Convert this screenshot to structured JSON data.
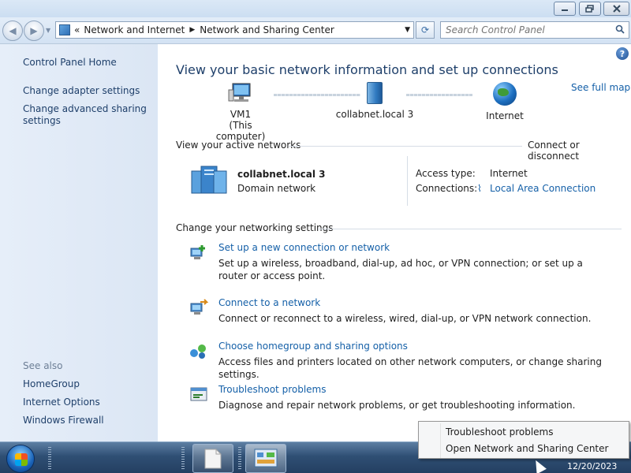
{
  "window": {
    "minimize_icon": "minimize-icon",
    "maximize_icon": "restore-icon",
    "close_icon": "close-icon"
  },
  "navbar": {
    "breadcrumb_prefix": "«",
    "crumbs": [
      "Network and Internet",
      "Network and Sharing Center"
    ],
    "search_placeholder": "Search Control Panel"
  },
  "sidebar": {
    "home": "Control Panel Home",
    "items": [
      "Change adapter settings",
      "Change advanced sharing settings"
    ],
    "see_also_label": "See also",
    "see_also": [
      "HomeGroup",
      "Internet Options",
      "Windows Firewall"
    ]
  },
  "main": {
    "heading": "View your basic network information and set up connections",
    "see_full_map": "See full map",
    "map": {
      "computer_name": "VM1",
      "computer_sub": "(This computer)",
      "network": "collabnet.local  3",
      "internet": "Internet"
    },
    "active_networks_label": "View your active networks",
    "connect_disconnect": "Connect or disconnect",
    "active_network": {
      "name": "collabnet.local  3",
      "type": "Domain network",
      "access_type_label": "Access type:",
      "access_type_value": "Internet",
      "connections_label": "Connections:",
      "connections_value": "Local Area Connection"
    },
    "change_settings_label": "Change your networking settings",
    "tasks": [
      {
        "title": "Set up a new connection or network",
        "desc": "Set up a wireless, broadband, dial-up, ad hoc, or VPN connection; or set up a router or access point."
      },
      {
        "title": "Connect to a network",
        "desc": "Connect or reconnect to a wireless, wired, dial-up, or VPN network connection."
      },
      {
        "title": "Choose homegroup and sharing options",
        "desc": "Access files and printers located on other network computers, or change sharing settings."
      },
      {
        "title": "Troubleshoot problems",
        "desc": "Diagnose and repair network problems, or get troubleshooting information."
      }
    ]
  },
  "context_menu": {
    "items": [
      "Troubleshoot problems",
      "Open Network and Sharing Center"
    ]
  },
  "taskbar": {
    "date": "12/20/2023"
  },
  "colors": {
    "link": "#1560a8",
    "sidebar_bg": "#e6eef9",
    "heading": "#1e3f6a"
  }
}
